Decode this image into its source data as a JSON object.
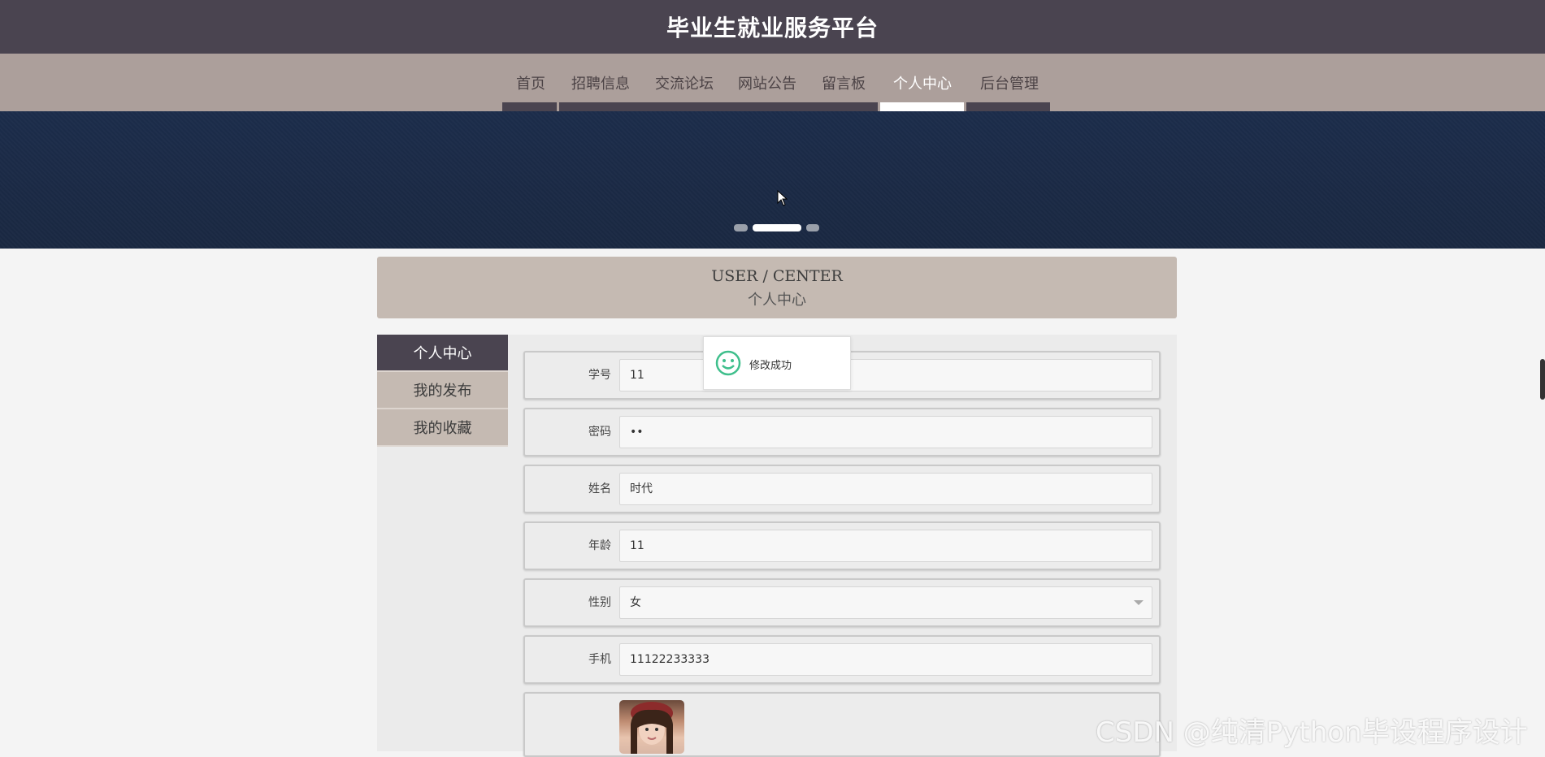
{
  "site_title": "毕业生就业服务平台",
  "nav": {
    "items": [
      "首页",
      "招聘信息",
      "交流论坛",
      "网站公告",
      "留言板",
      "个人中心",
      "后台管理"
    ],
    "active_index": 5
  },
  "banner": {
    "slide_count": 3,
    "active_slide": 1
  },
  "section": {
    "title_en": "USER / CENTER",
    "title_cn": "个人中心"
  },
  "sidebar": {
    "items": [
      "个人中心",
      "我的发布",
      "我的收藏"
    ],
    "active_index": 0
  },
  "form": {
    "fields": [
      {
        "label": "学号",
        "value": "11"
      },
      {
        "label": "密码",
        "value": "••"
      },
      {
        "label": "姓名",
        "value": "时代"
      },
      {
        "label": "年龄",
        "value": "11"
      },
      {
        "label": "性别",
        "value": "女"
      },
      {
        "label": "手机",
        "value": "11122233333"
      }
    ]
  },
  "toast": {
    "message": "修改成功"
  },
  "watermark": "CSDN @纯清Python毕设程序设计",
  "colors": {
    "header": "#4a4450",
    "nav": "#ac9f9b",
    "accent": "#c5bab2",
    "banner": "#1c2d4b"
  }
}
